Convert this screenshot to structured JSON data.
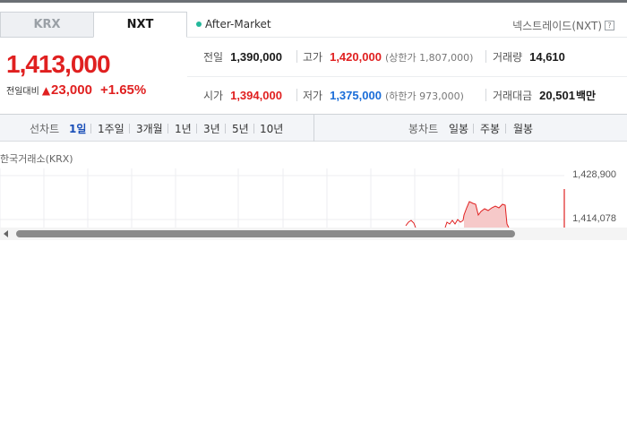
{
  "tabs": [
    {
      "label": "KRX",
      "active": false
    },
    {
      "label": "NXT",
      "active": true
    }
  ],
  "session": {
    "label": "After-Market",
    "dot_color": "#23b89b"
  },
  "provider": {
    "label": "넥스트레이드(NXT)",
    "help_icon": "help-icon",
    "help_glyph": "?"
  },
  "price": {
    "current": "1,413,000",
    "change_label": "전일대비",
    "change_direction": "up",
    "change_arrow": "▲",
    "change_amount": "23,000",
    "change_percent": "+1.65%"
  },
  "stats": {
    "prev_close": {
      "label": "전일",
      "value": "1,390,000"
    },
    "high": {
      "label": "고가",
      "value": "1,420,000",
      "limit_note": "(상한가 1,807,000)"
    },
    "volume": {
      "label": "거래량",
      "value": "14,610"
    },
    "open": {
      "label": "시가",
      "value": "1,394,000"
    },
    "low": {
      "label": "저가",
      "value": "1,375,000",
      "limit_note": "(하한가 973,000)"
    },
    "trade_value": {
      "label": "거래대금",
      "value": "20,501",
      "unit": "백만"
    }
  },
  "toolbar": {
    "line_chart_label": "선차트",
    "periods": [
      "1일",
      "1주일",
      "3개월",
      "1년",
      "3년",
      "5년",
      "10년"
    ],
    "active_period": "1일",
    "candle_chart_label": "봉차트",
    "candle_periods": [
      "일봉",
      "주봉",
      "월봉"
    ]
  },
  "chart": {
    "source_label": "한국거래소(KRX)",
    "y_ticks": [
      "1,428,900",
      "1,414,078"
    ],
    "line_color": "#e02020",
    "fill_color": "#f6c9c9"
  },
  "colors": {
    "up": "#e02020",
    "down": "#1a6dd8",
    "active_tab": "#1a4fb8"
  }
}
